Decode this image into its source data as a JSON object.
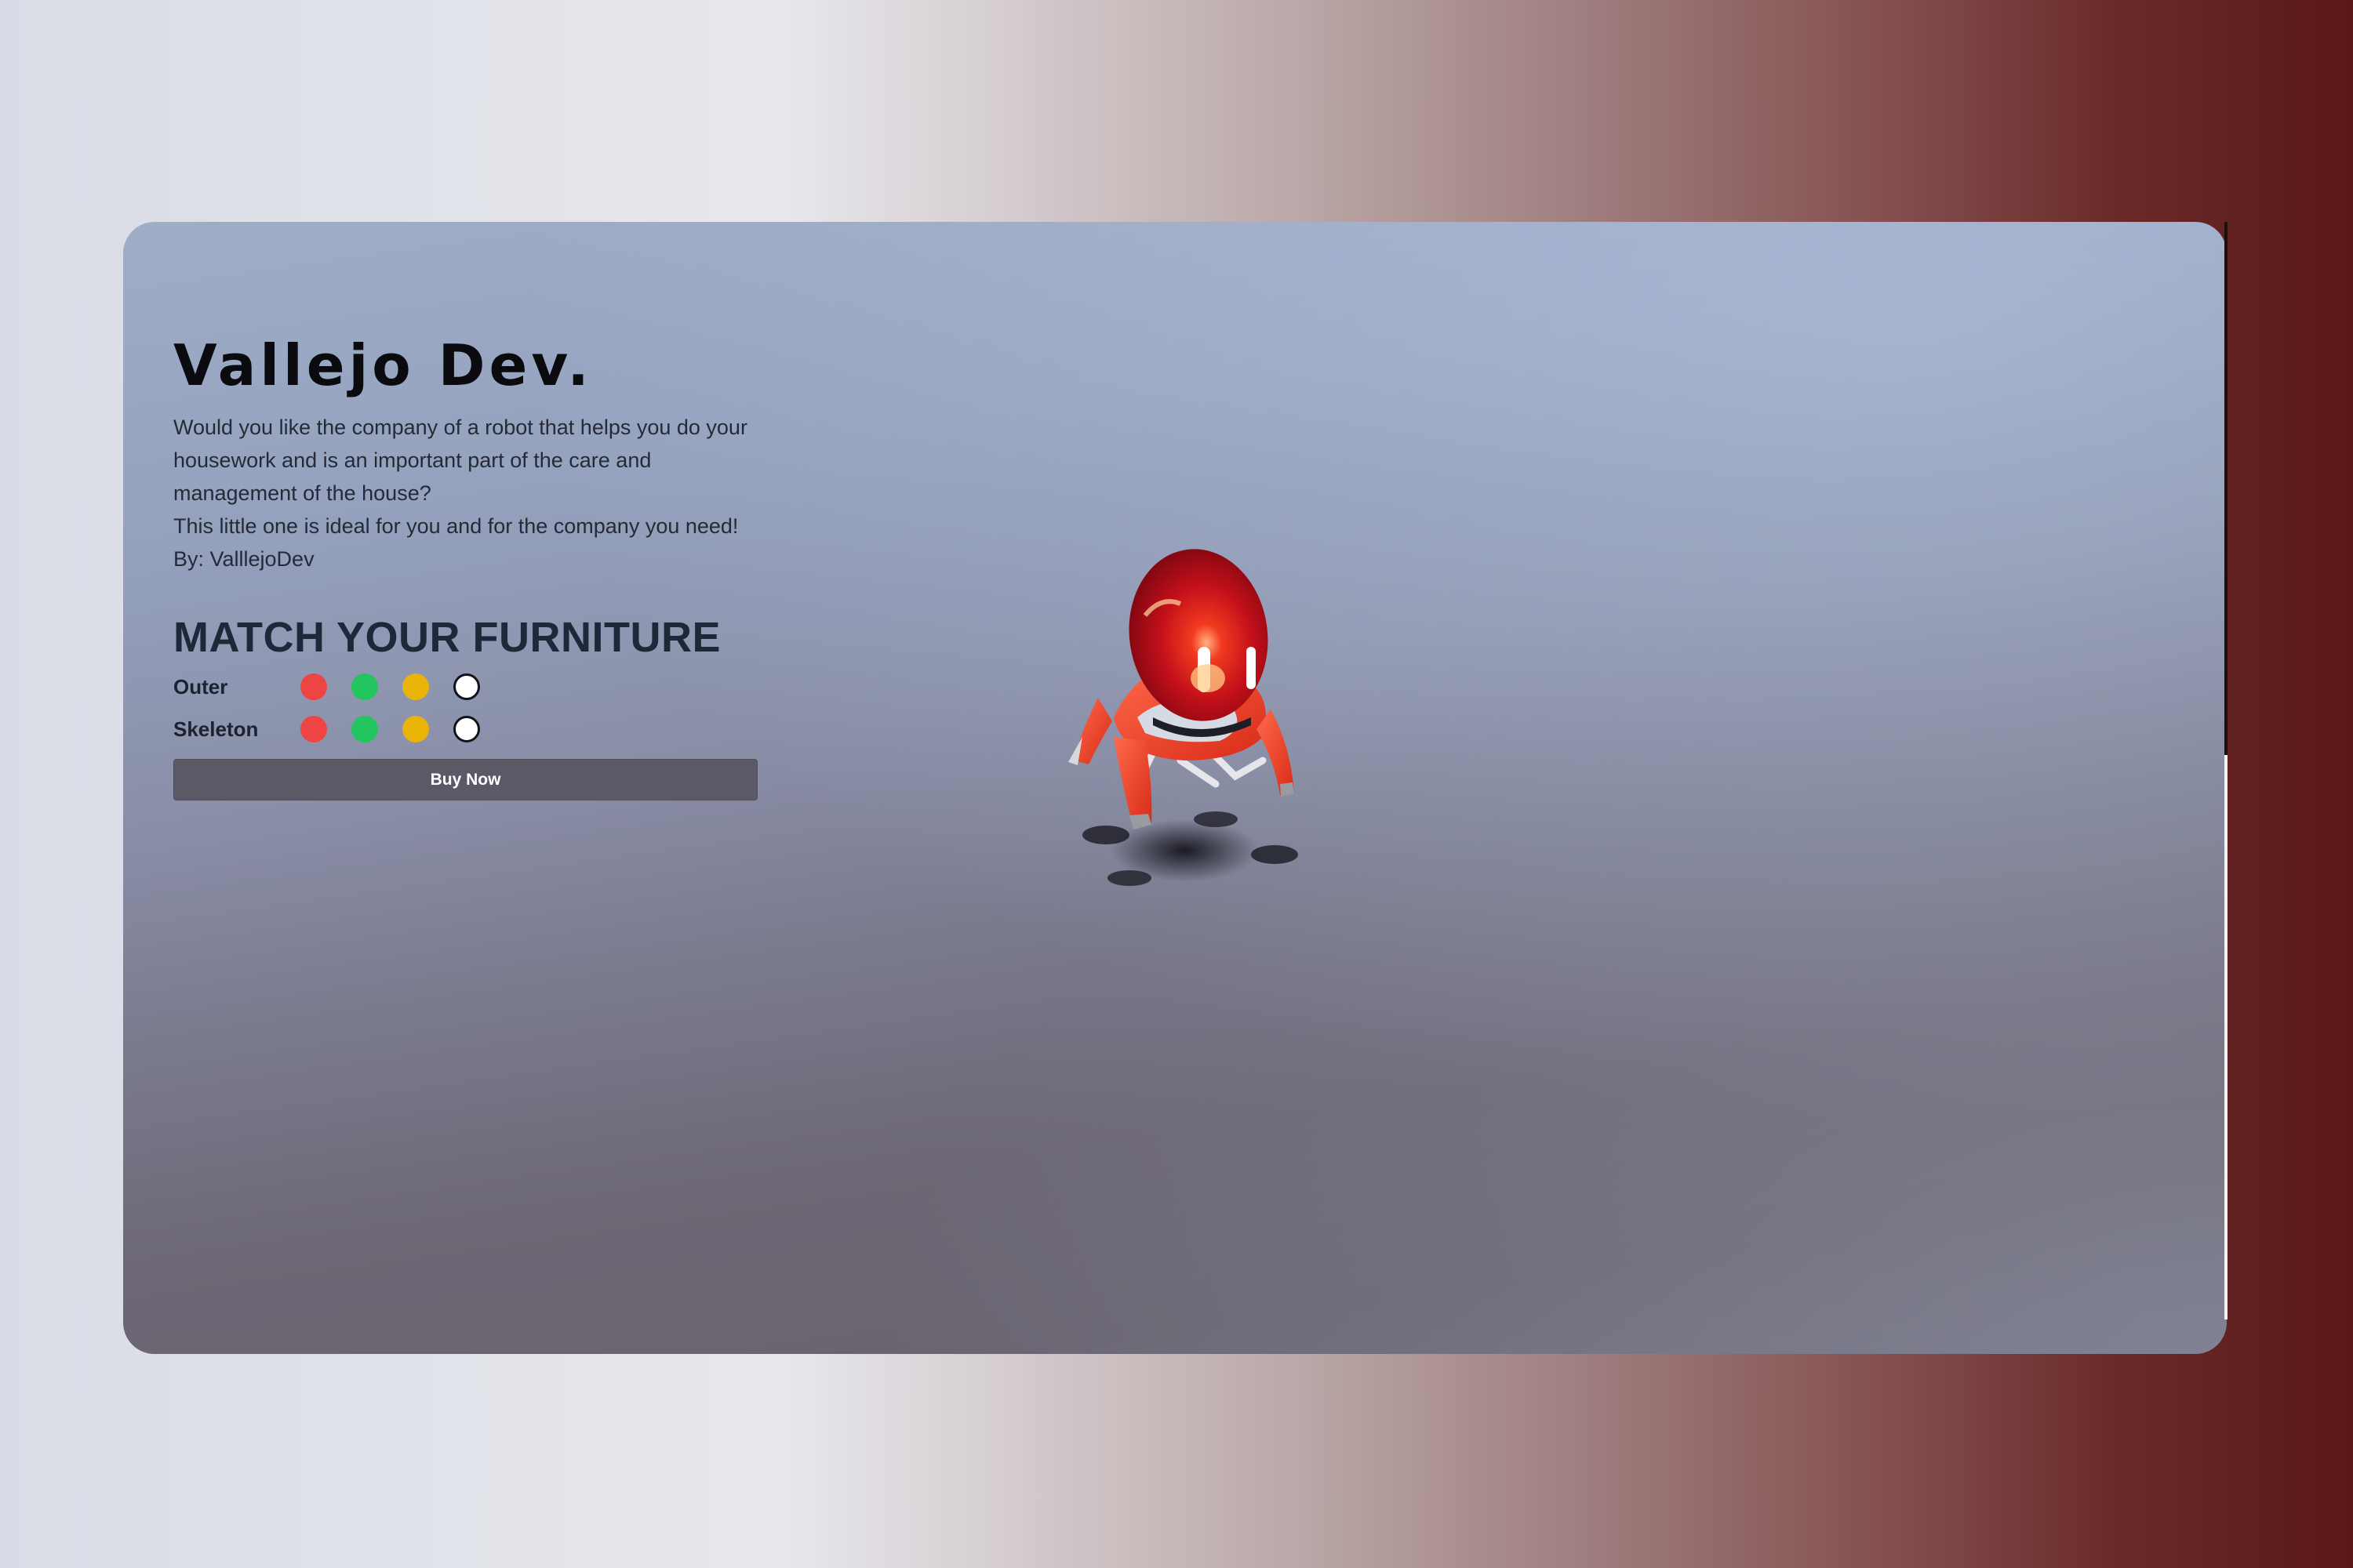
{
  "brand": {
    "title": "Vallejo Dev."
  },
  "description": {
    "line1": "Would you like the company of a robot that helps you do your housework and is an important part of the care and management of the house?",
    "line2": "This little one is ideal for you and for the company you need!",
    "line3": "By: ValllejoDev"
  },
  "customize": {
    "heading": "MATCH YOUR FURNITURE",
    "rows": [
      {
        "label": "Outer",
        "swatches": [
          {
            "name": "red",
            "color": "#ef4444"
          },
          {
            "name": "green",
            "color": "#22c55e"
          },
          {
            "name": "yellow",
            "color": "#eab308"
          },
          {
            "name": "white",
            "color": "#ffffff"
          }
        ]
      },
      {
        "label": "Skeleton",
        "swatches": [
          {
            "name": "red",
            "color": "#ef4444"
          },
          {
            "name": "green",
            "color": "#22c55e"
          },
          {
            "name": "yellow",
            "color": "#eab308"
          },
          {
            "name": "white",
            "color": "#ffffff"
          }
        ]
      }
    ]
  },
  "cta": {
    "buy_label": "Buy Now"
  },
  "viewer": {
    "model": "robot-3d-model",
    "body_color": "#e8321f",
    "head_color": "#c8141a"
  }
}
